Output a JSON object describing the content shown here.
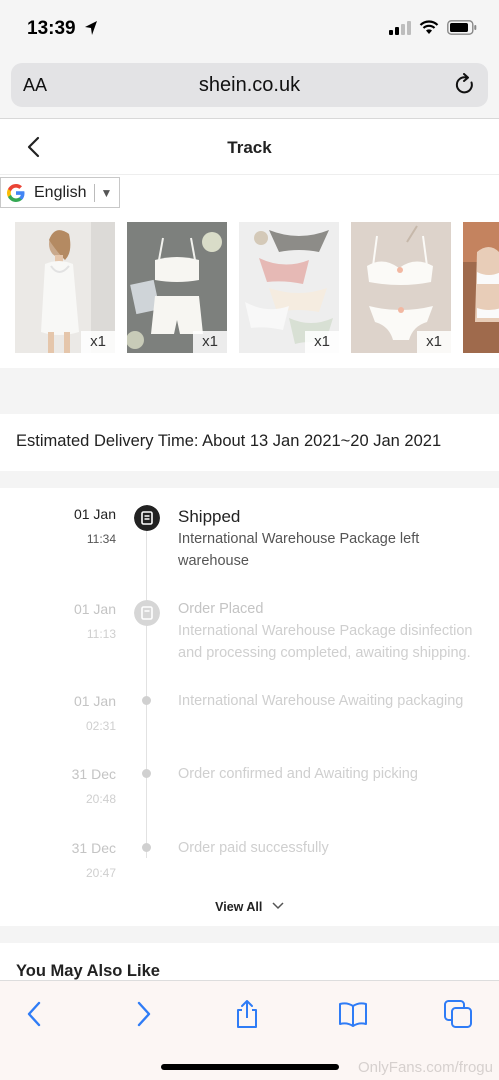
{
  "status": {
    "time": "13:39"
  },
  "browser": {
    "text_size_label": "AA",
    "url": "shein.co.uk"
  },
  "page": {
    "title": "Track"
  },
  "translate": {
    "language": "English"
  },
  "items": [
    {
      "qty": "x1"
    },
    {
      "qty": "x1"
    },
    {
      "qty": "x1"
    },
    {
      "qty": "x1"
    }
  ],
  "delivery": {
    "text": "Estimated Delivery Time: About 13 Jan 2021~20 Jan 2021"
  },
  "timeline": [
    {
      "date": "01 Jan",
      "time": "11:34",
      "status": "Shipped",
      "desc": "International Warehouse Package left warehouse"
    },
    {
      "date": "01 Jan",
      "time": "11:13",
      "status": "Order Placed",
      "desc": "International Warehouse Package disinfection and processing completed, awaiting shipping."
    },
    {
      "date": "01 Jan",
      "time": "02:31",
      "desc": "International Warehouse Awaiting packaging"
    },
    {
      "date": "31 Dec",
      "time": "20:48",
      "desc": "Order confirmed and Awaiting picking"
    },
    {
      "date": "31 Dec",
      "time": "20:47",
      "desc": "Order paid successfully"
    }
  ],
  "view_all": "View All",
  "also_like": "You May Also Like",
  "watermark": "OnlyFans.com/frogu",
  "colors": {
    "active": "#222222",
    "inactive": "#c4c4c4",
    "ios_blue": "#2f7cf6"
  }
}
